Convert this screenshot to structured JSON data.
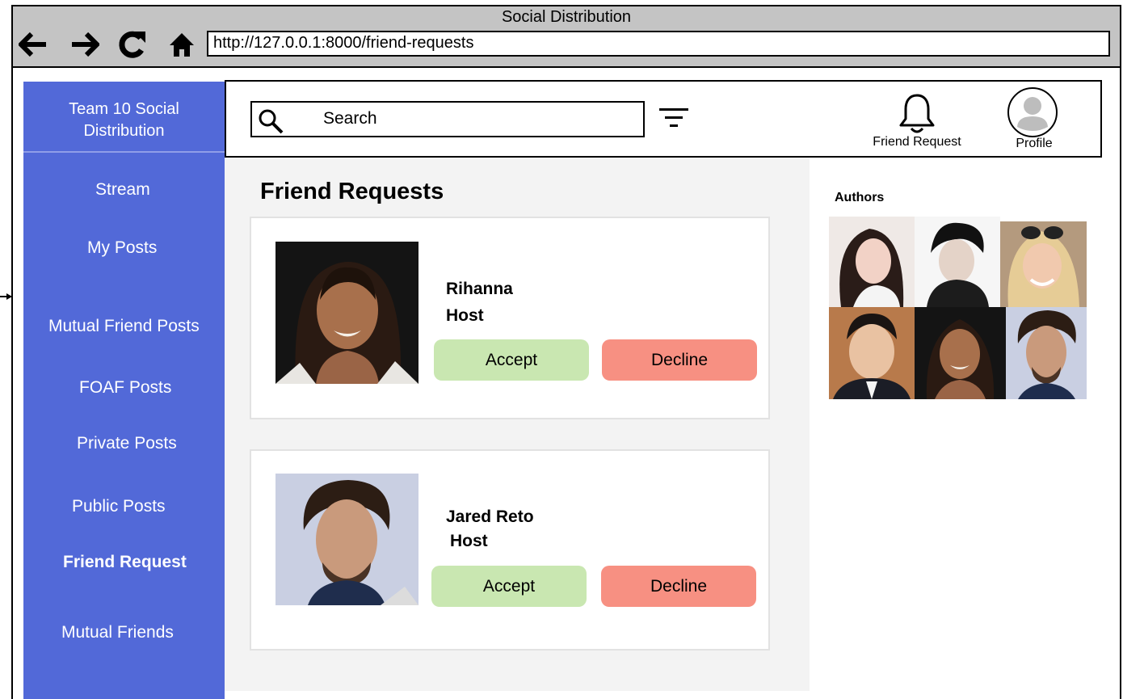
{
  "browser": {
    "window_title": "Social Distribution",
    "url": "http://127.0.0.1:8000/friend-requests",
    "nav_icons": [
      "arrow-left-icon",
      "arrow-right-icon",
      "reload-icon",
      "home-icon"
    ]
  },
  "sidebar": {
    "brand_line1": "Team 10 Social",
    "brand_line2": "Distribution",
    "items": [
      {
        "label": "Stream"
      },
      {
        "label": "My Posts"
      },
      {
        "label": "Mutual Friend Posts"
      },
      {
        "label": "FOAF Posts"
      },
      {
        "label": "Private Posts"
      },
      {
        "label": "Public Posts"
      },
      {
        "label": "Friend Request",
        "active": true
      },
      {
        "label": "Mutual Friends"
      }
    ],
    "color": "#5269d8"
  },
  "header": {
    "search_label": "Search",
    "notification_label": "Friend Request",
    "profile_label": "Profile"
  },
  "main": {
    "title": "Friend Requests",
    "requests": [
      {
        "name": "Rihanna",
        "role": "Host",
        "accept_label": "Accept",
        "decline_label": "Decline"
      },
      {
        "name": "Jared Reto",
        "role": "Host",
        "accept_label": "Accept",
        "decline_label": "Decline"
      }
    ]
  },
  "authors": {
    "title": "Authors"
  },
  "colors": {
    "accept": "#c9e7b1",
    "decline": "#f79082",
    "panel_bg": "#f3f3f3"
  }
}
